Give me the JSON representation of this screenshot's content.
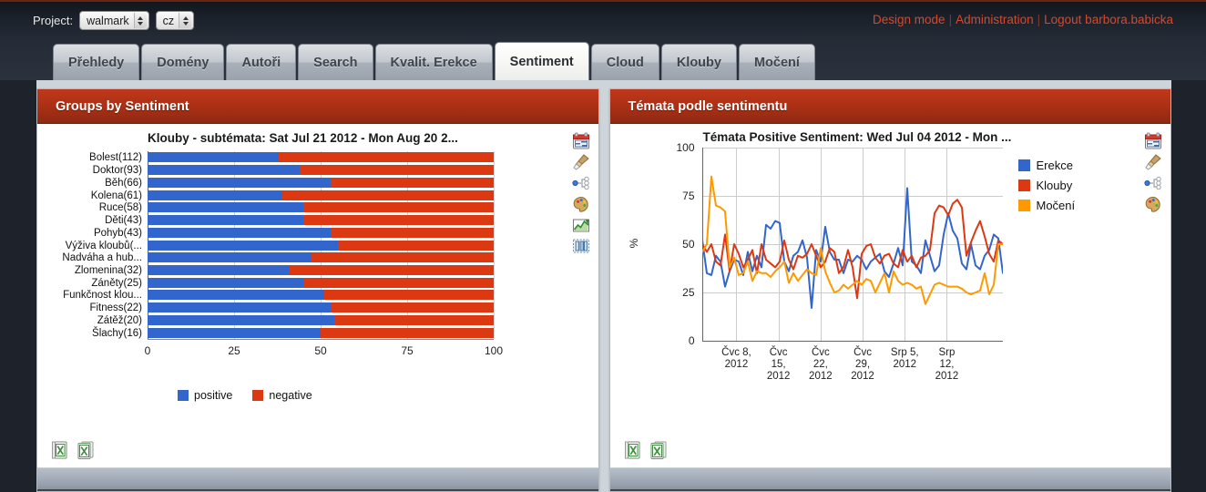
{
  "topbar": {
    "project_label": "Project:",
    "project_value": "walmark",
    "lang_value": "cz",
    "links": {
      "design_mode": "Design mode",
      "administration": "Administration",
      "logout": "Logout barbora.babicka",
      "sep": "|"
    },
    "accent_color": "#d9472a"
  },
  "tabs": [
    {
      "label": "Přehledy",
      "active": false
    },
    {
      "label": "Domény",
      "active": false
    },
    {
      "label": "Autoři",
      "active": false
    },
    {
      "label": "Search",
      "active": false
    },
    {
      "label": "Kvalit. Erekce",
      "active": false
    },
    {
      "label": "Sentiment",
      "active": true
    },
    {
      "label": "Cloud",
      "active": false
    },
    {
      "label": "Klouby",
      "active": false
    },
    {
      "label": "Močení",
      "active": false
    }
  ],
  "panels": {
    "left": {
      "title": "Groups by Sentiment",
      "header_color": "#a92f14",
      "tools": [
        "calendar-icon",
        "brush-icon",
        "node-graph-icon",
        "palette-icon",
        "line-chart-icon",
        "bar-chart-icon"
      ],
      "exports": [
        "excel-export-icon",
        "excel-export-multi-icon"
      ]
    },
    "right": {
      "title": "Témata podle sentimentu",
      "header_color": "#a92f14",
      "tools": [
        "calendar-icon",
        "brush-icon",
        "node-graph-icon",
        "palette-icon"
      ],
      "exports": [
        "excel-export-icon",
        "excel-export-multi-icon"
      ]
    }
  },
  "chart_data": [
    {
      "type": "bar",
      "id": "groups-by-sentiment",
      "title": "Klouby - subtémata: Sat Jul 21 2012 - Mon Aug 20 2...",
      "orientation": "horizontal",
      "stacked": true,
      "percent": true,
      "xlabel": "",
      "ylabel": "",
      "xlim": [
        0,
        100
      ],
      "xticks": [
        "0",
        "25",
        "50",
        "75",
        "100"
      ],
      "grid": true,
      "legend_position": "bottom",
      "categories": [
        "Bolest(112)",
        "Doktor(93)",
        "Běh(66)",
        "Kolena(61)",
        "Ruce(58)",
        "Děti(43)",
        "Pohyb(43)",
        "Výživa kloubů(...",
        "Nadváha a hub...",
        "Zlomenina(32)",
        "Záněty(25)",
        "Funkčnost klou...",
        "Fitness(22)",
        "Zátěž(20)",
        "Šlachy(16)"
      ],
      "series": [
        {
          "name": "positive",
          "color": "#3366cc",
          "values": [
            38,
            44,
            53,
            39,
            45,
            45,
            53,
            55,
            47,
            41,
            45,
            51,
            53,
            54,
            50
          ]
        },
        {
          "name": "negative",
          "color": "#dc3912",
          "values": [
            62,
            56,
            47,
            61,
            55,
            55,
            47,
            45,
            53,
            59,
            55,
            49,
            47,
            46,
            50
          ]
        }
      ]
    },
    {
      "type": "line",
      "id": "temata-positive-sentiment",
      "title": "Témata Positive Sentiment: Wed Jul 04 2012 - Mon ...",
      "xlabel": "",
      "ylabel": "%",
      "ylim": [
        0,
        100
      ],
      "yticks": [
        "0",
        "25",
        "50",
        "75",
        "100"
      ],
      "grid": true,
      "legend_position": "right",
      "xticklabels": [
        "Čvc 8,\n2012",
        "Čvc\n15,\n2012",
        "Čvc\n22,\n2012",
        "Čvc\n29,\n2012",
        "Srp 5,\n2012",
        "Srp\n12,\n2012"
      ],
      "xtick_positions": [
        0.115,
        0.255,
        0.395,
        0.535,
        0.675,
        0.815
      ],
      "series": [
        {
          "name": "Erekce",
          "color": "#3366cc",
          "values": [
            52,
            35,
            34,
            44,
            41,
            28,
            36,
            42,
            41,
            34,
            46,
            36,
            44,
            38,
            60,
            58,
            62,
            61,
            41,
            36,
            44,
            46,
            52,
            43,
            17,
            47,
            41,
            59,
            46,
            42,
            42,
            35,
            42,
            41,
            44,
            42,
            37,
            41,
            43,
            45,
            36,
            33,
            40,
            48,
            39,
            79,
            41,
            39,
            35,
            52,
            44,
            36,
            39,
            55,
            66,
            57,
            53,
            40,
            37,
            50,
            39,
            37,
            44,
            47,
            55,
            53,
            35
          ]
        },
        {
          "name": "Klouby",
          "color": "#dc3912",
          "values": [
            50,
            46,
            50,
            41,
            39,
            55,
            36,
            50,
            45,
            38,
            42,
            47,
            35,
            50,
            42,
            40,
            38,
            41,
            52,
            42,
            37,
            44,
            43,
            45,
            50,
            44,
            38,
            41,
            48,
            46,
            35,
            38,
            47,
            38,
            22,
            45,
            49,
            50,
            43,
            40,
            44,
            45,
            40,
            38,
            47,
            41,
            44,
            38,
            43,
            44,
            47,
            66,
            70,
            69,
            65,
            71,
            73,
            69,
            44,
            51,
            57,
            62,
            54,
            45,
            41,
            52,
            50
          ]
        },
        {
          "name": "Močení",
          "color": "#ff9900",
          "values": [
            46,
            50,
            85,
            70,
            69,
            67,
            38,
            43,
            34,
            35,
            41,
            31,
            36,
            35,
            35,
            33,
            36,
            38,
            41,
            30,
            35,
            31,
            34,
            37,
            35,
            34,
            48,
            36,
            30,
            25,
            26,
            29,
            27,
            29,
            31,
            29,
            32,
            31,
            25,
            30,
            35,
            25,
            36,
            31,
            29,
            30,
            29,
            27,
            28,
            19,
            24,
            29,
            30,
            29,
            28,
            28,
            28,
            27,
            25,
            24,
            25,
            26,
            35,
            24,
            29,
            50,
            50
          ]
        }
      ]
    }
  ]
}
